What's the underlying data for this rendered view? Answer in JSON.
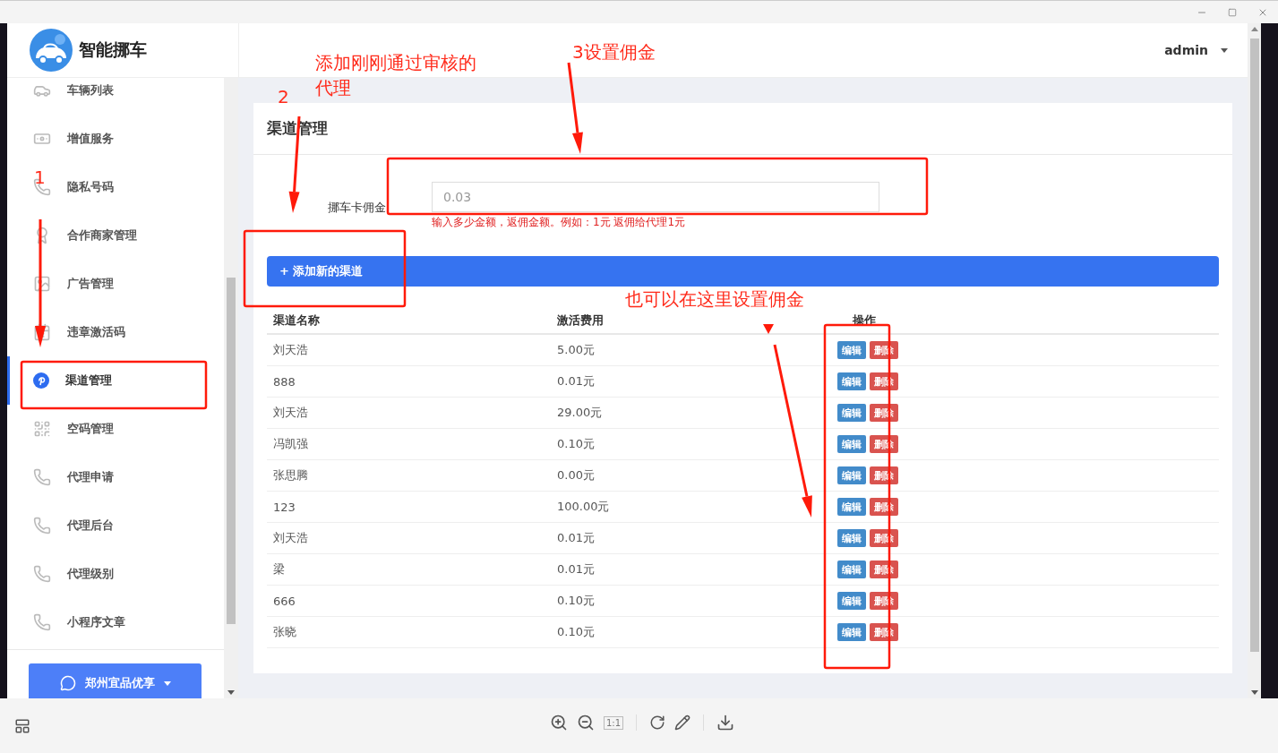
{
  "viewer": {
    "toolbar": {
      "fit_label": "1:1"
    }
  },
  "app": {
    "logo_text": "智能挪车",
    "user": "admin",
    "sidebar": {
      "items": [
        {
          "label": "车辆列表",
          "selected": false
        },
        {
          "label": "增值服务",
          "selected": false
        },
        {
          "label": "隐私号码",
          "selected": false
        },
        {
          "label": "合作商家管理",
          "selected": false
        },
        {
          "label": "广告管理",
          "selected": false
        },
        {
          "label": "违章激活码",
          "selected": false
        },
        {
          "label": "渠道管理",
          "selected": true
        },
        {
          "label": "空码管理",
          "selected": false
        },
        {
          "label": "代理申请",
          "selected": false
        },
        {
          "label": "代理后台",
          "selected": false
        },
        {
          "label": "代理级别",
          "selected": false
        },
        {
          "label": "小程序文章",
          "selected": false
        }
      ],
      "shop_button": "郑州宜品优享"
    },
    "card": {
      "title": "渠道管理",
      "form": {
        "label": "挪车卡佣金",
        "value": "0.03",
        "hint": "输入多少金额，返佣金额。例如：1元 返佣给代理1元"
      },
      "add_button": "+ 添加新的渠道",
      "table": {
        "columns": [
          "渠道名称",
          "激活费用",
          "操作"
        ],
        "rows": [
          {
            "name": "刘天浩",
            "fee": "5.00元",
            "edit": "编辑",
            "delete": "删除"
          },
          {
            "name": "888",
            "fee": "0.01元",
            "edit": "编辑",
            "delete": "删除"
          },
          {
            "name": "刘天浩",
            "fee": "29.00元",
            "edit": "编辑",
            "delete": "删除"
          },
          {
            "name": "冯凯强",
            "fee": "0.10元",
            "edit": "编辑",
            "delete": "删除"
          },
          {
            "name": "张思腾",
            "fee": "0.00元",
            "edit": "编辑",
            "delete": "删除"
          },
          {
            "name": "123",
            "fee": "100.00元",
            "edit": "编辑",
            "delete": "删除"
          },
          {
            "name": "刘天浩",
            "fee": "0.01元",
            "edit": "编辑",
            "delete": "删除"
          },
          {
            "name": "梁",
            "fee": "0.01元",
            "edit": "编辑",
            "delete": "删除"
          },
          {
            "name": "666",
            "fee": "0.10元",
            "edit": "编辑",
            "delete": "删除"
          },
          {
            "name": "张晓",
            "fee": "0.10元",
            "edit": "编辑",
            "delete": "删除"
          }
        ]
      }
    }
  },
  "annotations": [
    {
      "text": "添加刚刚通过审核的"
    },
    {
      "text": "代理"
    },
    {
      "text": "2"
    },
    {
      "text": "3设置佣金"
    },
    {
      "text": "1"
    },
    {
      "text": "也可以在这里设置佣金"
    }
  ]
}
